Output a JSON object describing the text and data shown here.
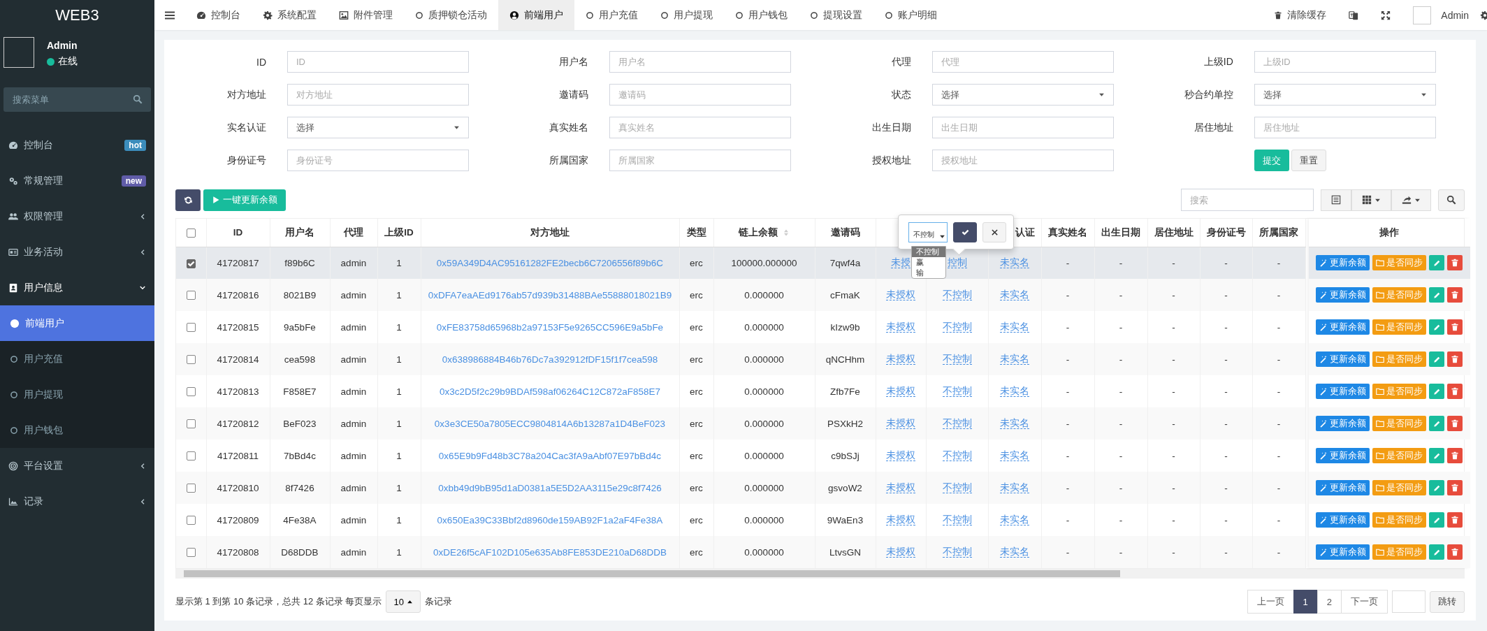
{
  "sidebar": {
    "logo": "WEB3",
    "user": {
      "name": "Admin",
      "status": "在线"
    },
    "search": {
      "placeholder": "搜索菜单"
    },
    "items": [
      {
        "label": "控制台",
        "badge": {
          "text": "hot",
          "color": "#3c8dbc"
        }
      },
      {
        "label": "常规管理",
        "badge": {
          "text": "new",
          "color": "#605ca8"
        }
      },
      {
        "label": "权限管理",
        "expanded": false
      },
      {
        "label": "业务活动",
        "expanded": false
      },
      {
        "label": "用户信息",
        "expanded": true,
        "children": [
          {
            "label": "前端用户",
            "selected": true
          },
          {
            "label": "用户充值",
            "selected": false
          },
          {
            "label": "用户提现",
            "selected": false
          },
          {
            "label": "用户钱包",
            "selected": false
          }
        ]
      },
      {
        "label": "平台设置",
        "expanded": false
      },
      {
        "label": "记录",
        "expanded": false
      }
    ]
  },
  "top_nav": {
    "tabs": [
      {
        "label": "控制台",
        "selected": false
      },
      {
        "label": "系统配置",
        "selected": false
      },
      {
        "label": "附件管理",
        "selected": false
      },
      {
        "label": "质押锁仓活动",
        "selected": false
      },
      {
        "label": "前端用户",
        "selected": true
      },
      {
        "label": "用户充值",
        "selected": false
      },
      {
        "label": "用户提现",
        "selected": false
      },
      {
        "label": "用户钱包",
        "selected": false
      },
      {
        "label": "提现设置",
        "selected": false
      },
      {
        "label": "账户明细",
        "selected": false
      }
    ],
    "clear_cache": "清除缓存",
    "user": "Admin"
  },
  "filter_form": {
    "fields": [
      {
        "label": "ID",
        "kind": "text",
        "placeholder": "ID"
      },
      {
        "label": "用户名",
        "kind": "text",
        "placeholder": "用户名"
      },
      {
        "label": "代理",
        "kind": "text",
        "placeholder": "代理"
      },
      {
        "label": "上级ID",
        "kind": "text",
        "placeholder": "上级ID"
      },
      {
        "label": "对方地址",
        "kind": "text",
        "placeholder": "对方地址"
      },
      {
        "label": "邀请码",
        "kind": "text",
        "placeholder": "邀请码"
      },
      {
        "label": "状态",
        "kind": "select",
        "value": "选择"
      },
      {
        "label": "秒合约单控",
        "kind": "select",
        "value": "选择"
      },
      {
        "label": "实名认证",
        "kind": "select",
        "value": "选择"
      },
      {
        "label": "真实姓名",
        "kind": "text",
        "placeholder": "真实姓名"
      },
      {
        "label": "出生日期",
        "kind": "text",
        "placeholder": "出生日期"
      },
      {
        "label": "居住地址",
        "kind": "text",
        "placeholder": "居住地址"
      },
      {
        "label": "身份证号",
        "kind": "text",
        "placeholder": "身份证号"
      },
      {
        "label": "所属国家",
        "kind": "text",
        "placeholder": "所属国家"
      },
      {
        "label": "授权地址",
        "kind": "text",
        "placeholder": "授权地址"
      }
    ],
    "buttons": [
      "提交",
      "重置"
    ]
  },
  "toolbar": {
    "update_button": "一键更新余额",
    "search": {
      "placeholder": "搜索"
    }
  },
  "table": {
    "header_checked": false,
    "columns": [
      {
        "label": "ID"
      },
      {
        "label": "用户名"
      },
      {
        "label": "代理"
      },
      {
        "label": "上级ID"
      },
      {
        "label": "对方地址"
      },
      {
        "label": "类型"
      },
      {
        "label": "链上余额",
        "sortable": true
      },
      {
        "label": "邀请码"
      },
      {},
      {},
      {
        "label": "认证"
      },
      {
        "label": "真实姓名"
      },
      {
        "label": "出生日期"
      },
      {
        "label": "居住地址"
      },
      {
        "label": "身份证号"
      },
      {
        "label": "所属国家"
      },
      {
        "label": "操作"
      }
    ],
    "rows": [
      {
        "selected": true,
        "cells": [
          "41720817",
          "f89b6C",
          "admin",
          "1",
          "0x59A349D4AC95161282FE2becb6C7206556f89b6C",
          "erc",
          "100000.000000",
          "7qwf4a",
          "未授",
          "控制",
          "未实名",
          "-",
          "-",
          "-",
          "-",
          "-"
        ],
        "actions": [
          "更新余额",
          "是否同步"
        ]
      },
      {
        "selected": false,
        "cells": [
          "41720816",
          "8021B9",
          "admin",
          "1",
          "0xDFA7eaAEd9176ab57d939b31488BAe55888018021B9",
          "erc",
          "0.000000",
          "cFmaK",
          "未授权",
          "不控制",
          "未实名",
          "-",
          "-",
          "-",
          "-",
          "-"
        ],
        "actions": [
          "更新余额",
          "是否同步"
        ]
      },
      {
        "selected": false,
        "cells": [
          "41720815",
          "9a5bFe",
          "admin",
          "1",
          "0xFE83758d65968b2a97153F5e9265CC596E9a5bFe",
          "erc",
          "0.000000",
          "kIzw9b",
          "未授权",
          "不控制",
          "未实名",
          "-",
          "-",
          "-",
          "-",
          "-"
        ],
        "actions": [
          "更新余额",
          "是否同步"
        ]
      },
      {
        "selected": false,
        "cells": [
          "41720814",
          "cea598",
          "admin",
          "1",
          "0x638986884B46b76Dc7a392912fDF15f1f7cea598",
          "erc",
          "0.000000",
          "qNCHhm",
          "未授权",
          "不控制",
          "未实名",
          "-",
          "-",
          "-",
          "-",
          "-"
        ],
        "actions": [
          "更新余额",
          "是否同步"
        ]
      },
      {
        "selected": false,
        "cells": [
          "41720813",
          "F858E7",
          "admin",
          "1",
          "0x3c2D5f2c29b9BDAf598af06264C12C872aF858E7",
          "erc",
          "0.000000",
          "Zfb7Fe",
          "未授权",
          "不控制",
          "未实名",
          "-",
          "-",
          "-",
          "-",
          "-"
        ],
        "actions": [
          "更新余额",
          "是否同步"
        ]
      },
      {
        "selected": false,
        "cells": [
          "41720812",
          "BeF023",
          "admin",
          "1",
          "0x3e3CE50a7805ECC9804814A6b13287a1D4BeF023",
          "erc",
          "0.000000",
          "PSXkH2",
          "未授权",
          "不控制",
          "未实名",
          "-",
          "-",
          "-",
          "-",
          "-"
        ],
        "actions": [
          "更新余额",
          "是否同步"
        ]
      },
      {
        "selected": false,
        "cells": [
          "41720811",
          "7bBd4c",
          "admin",
          "1",
          "0x65E9b9Fd48b3C78a204Cac3fA9aAbf07E97bBd4c",
          "erc",
          "0.000000",
          "c9bSJj",
          "未授权",
          "不控制",
          "未实名",
          "-",
          "-",
          "-",
          "-",
          "-"
        ],
        "actions": [
          "更新余额",
          "是否同步"
        ]
      },
      {
        "selected": false,
        "cells": [
          "41720810",
          "8f7426",
          "admin",
          "1",
          "0xbb49d9bB95d1aD0381a5E5D2AA3115e29c8f7426",
          "erc",
          "0.000000",
          "gsvoW2",
          "未授权",
          "不控制",
          "未实名",
          "-",
          "-",
          "-",
          "-",
          "-"
        ],
        "actions": [
          "更新余额",
          "是否同步"
        ]
      },
      {
        "selected": false,
        "cells": [
          "41720809",
          "4Fe38A",
          "admin",
          "1",
          "0x650Ea39C33Bbf2d8960de159AB92F1a2aF4Fe38A",
          "erc",
          "0.000000",
          "9WaEn3",
          "未授权",
          "不控制",
          "未实名",
          "-",
          "-",
          "-",
          "-",
          "-"
        ],
        "actions": [
          "更新余额",
          "是否同步"
        ]
      },
      {
        "selected": false,
        "cells": [
          "41720808",
          "D68DDB",
          "admin",
          "1",
          "0xDE26f5cAF102D105e635Ab8FE853DE210aD68DDB",
          "erc",
          "0.000000",
          "LtvsGN",
          "未授权",
          "不控制",
          "未实名",
          "-",
          "-",
          "-",
          "-",
          "-"
        ],
        "actions": [
          "更新余额",
          "是否同步"
        ]
      }
    ]
  },
  "editor_popover": {
    "value": "不控制",
    "options": [
      {
        "label": "不控制",
        "selected": true
      },
      {
        "label": "赢",
        "selected": false
      },
      {
        "label": "输",
        "selected": false
      }
    ]
  },
  "footer": {
    "summary": "显示第 1 到第 10 条记录，总共 12 条记录 每页显示",
    "page_size": "10",
    "suffix": "条记录",
    "pagination": {
      "prev": "上一页",
      "pages": [
        {
          "label": "1",
          "selected": true
        },
        {
          "label": "2",
          "selected": false
        }
      ],
      "next": "下一页",
      "jump": "跳转"
    }
  }
}
